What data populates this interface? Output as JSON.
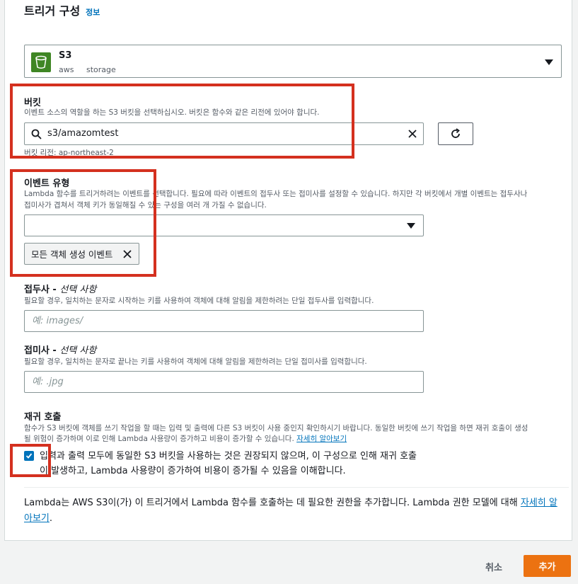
{
  "header": {
    "title": "트리거 구성",
    "info_link": "정보"
  },
  "source": {
    "name": "S3",
    "tags": [
      "aws",
      "storage"
    ]
  },
  "bucket": {
    "label": "버킷",
    "description": "이벤트 소스의 역할을 하는 S3 버킷을 선택하십시오. 버킷은 함수와 같은 리전에 있어야 합니다.",
    "value": "s3/amazomtest",
    "region": "버킷 리전: ap-northeast-2"
  },
  "event_type": {
    "label": "이벤트 유형",
    "description_line1": "Lambda 함수를 트리거하려는 이벤트를 선택합니다. 필요에 따라 이벤트의 접두사 또는 접미사를 설정할 수 있습니다. 하지만 각 버킷에서 개별 이벤트는 접두사나",
    "description_line2": "접미사가 겹쳐서 객체 키가 동일해질 수 있는 구성을 여러 개 가질 수 없습니다.",
    "selected_token": "모든 객체 생성 이벤트"
  },
  "prefix": {
    "label": "접두사 - ",
    "label_optional": "선택 사항",
    "description": "필요할 경우, 일치하는 문자로 시작하는 키를 사용하여 객체에 대해 알림을 제한하려는 단일 접두사를 입력합니다.",
    "placeholder": "예: images/"
  },
  "suffix": {
    "label": "접미사 - ",
    "label_optional": "선택 사항",
    "description": "필요할 경우, 일치하는 문자로 끝나는 키를 사용하여 객체에 대해 알림을 제한하려는 단일 접미사를 입력합니다.",
    "placeholder": "예: .jpg"
  },
  "recursion": {
    "label": "재귀 호출",
    "description_line1": "함수가 S3 버킷에 객체를 쓰기 작업을 할 때는 입력 및 출력에 다른 S3 버킷이 사용 중인지 확인하시기 바랍니다. 동일한 버킷에 쓰기 작업을 하면 재귀 호출이 생성",
    "description_line2": "될 위험이 증가하며 이로 인해 Lambda 사용량이 증가하고 비용이 증가할 수 있습니다.",
    "learn_more": "자세히 알아보기",
    "checkbox_line1": "입력과 출력 모두에 동일한 S3 버킷을 사용하는 것은 권장되지 않으며, 이 구성으로 인해 재귀 호출",
    "checkbox_line2": "이 발생하고, Lambda 사용량이 증가하여 비용이 증가될 수 있음을 이해합니다.",
    "checked": true
  },
  "notice": {
    "text": "Lambda는 AWS S3이(가) 이 트리거에서 Lambda 함수를 호출하는 데 필요한 권한을 추가합니다. Lambda 권한 모델에 대해 ",
    "link": "자세히 알아보기",
    "end": "."
  },
  "footer": {
    "cancel": "취소",
    "add": "추가"
  },
  "colors": {
    "primary": "#ec7211",
    "link": "#0073bb",
    "highlight": "#d4301f",
    "s3_green": "#3f8624"
  }
}
